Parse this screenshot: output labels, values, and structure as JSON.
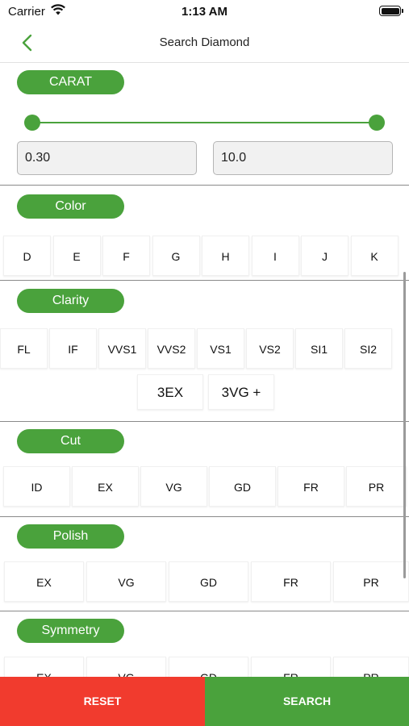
{
  "status_bar": {
    "carrier": "Carrier",
    "time": "1:13 AM"
  },
  "nav": {
    "title": "Search Diamond",
    "back_icon": "chevron-left-icon"
  },
  "colors": {
    "accent": "#4aa23c",
    "reset": "#f13b2e",
    "search": "#4aa23c"
  },
  "carat": {
    "label": "CARAT",
    "min_value": "0.30",
    "max_value": "10.0",
    "slider_low_fraction": 0,
    "slider_high_fraction": 1
  },
  "color": {
    "label": "Color",
    "options": [
      "D",
      "E",
      "F",
      "G",
      "H",
      "I",
      "J",
      "K"
    ]
  },
  "clarity": {
    "label": "Clarity",
    "options": [
      "FL",
      "IF",
      "VVS1",
      "VVS2",
      "VS1",
      "VS2",
      "SI1",
      "SI2"
    ],
    "shortcuts": [
      "3EX",
      "3VG +"
    ]
  },
  "cut": {
    "label": "Cut",
    "options": [
      "ID",
      "EX",
      "VG",
      "GD",
      "FR",
      "PR"
    ]
  },
  "polish": {
    "label": "Polish",
    "options": [
      "EX",
      "VG",
      "GD",
      "FR",
      "PR"
    ]
  },
  "symmetry": {
    "label": "Symmetry",
    "options": [
      "EX",
      "VG",
      "GD",
      "FR",
      "PR"
    ]
  },
  "footer": {
    "reset_label": "RESET",
    "search_label": "SEARCH"
  }
}
